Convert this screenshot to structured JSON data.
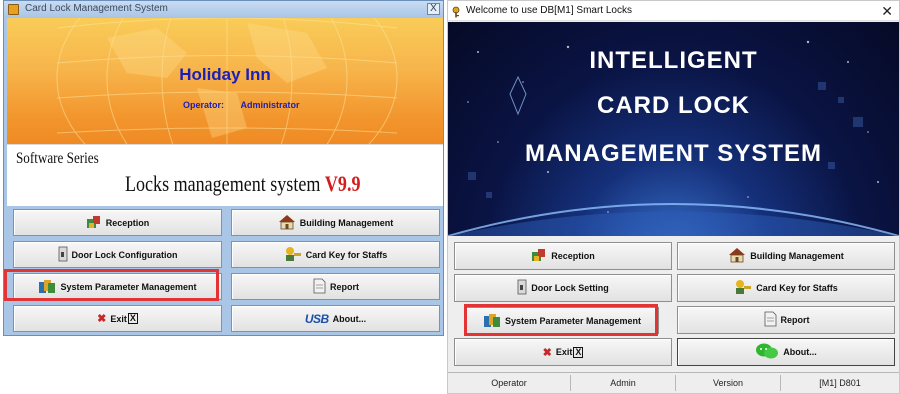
{
  "left_window": {
    "title": "Card Lock Management System",
    "close_label": "X",
    "hotel_name": "Holiday Inn",
    "operator_label": "Operator:",
    "operator_value": "Administrator",
    "series_text": "Software Series",
    "system_title": "Locks management system",
    "version": "V9.9",
    "buttons": {
      "reception": "Reception",
      "building": "Building Management",
      "door_lock": "Door Lock Configuration",
      "card_key": "Card Key for Staffs",
      "system_param": "System Parameter Management",
      "report": "Report",
      "exit": "Exit",
      "exit_hotkey": "X",
      "about": "About..."
    },
    "usb_badge": "USB"
  },
  "right_window": {
    "title": "Welcome to use DB[M1] Smart Locks",
    "close_label": "✕",
    "banner_lines": [
      "INTELLIGENT",
      "CARD LOCK",
      "MANAGEMENT SYSTEM"
    ],
    "buttons": {
      "reception": "Reception",
      "building": "Building Management",
      "door_lock": "Door Lock Setting",
      "card_key": "Card Key for Staffs",
      "system_param": "System Parameter Management",
      "report": "Report",
      "exit": "Exit",
      "exit_hotkey": "X",
      "about": "About..."
    },
    "status_bar": [
      "Operator",
      "Admin",
      "Version",
      "[M1] D801"
    ]
  },
  "colors": {
    "highlight": "#e23434",
    "hotel_text": "#1b1fb8",
    "version_red": "#d31c1c"
  }
}
